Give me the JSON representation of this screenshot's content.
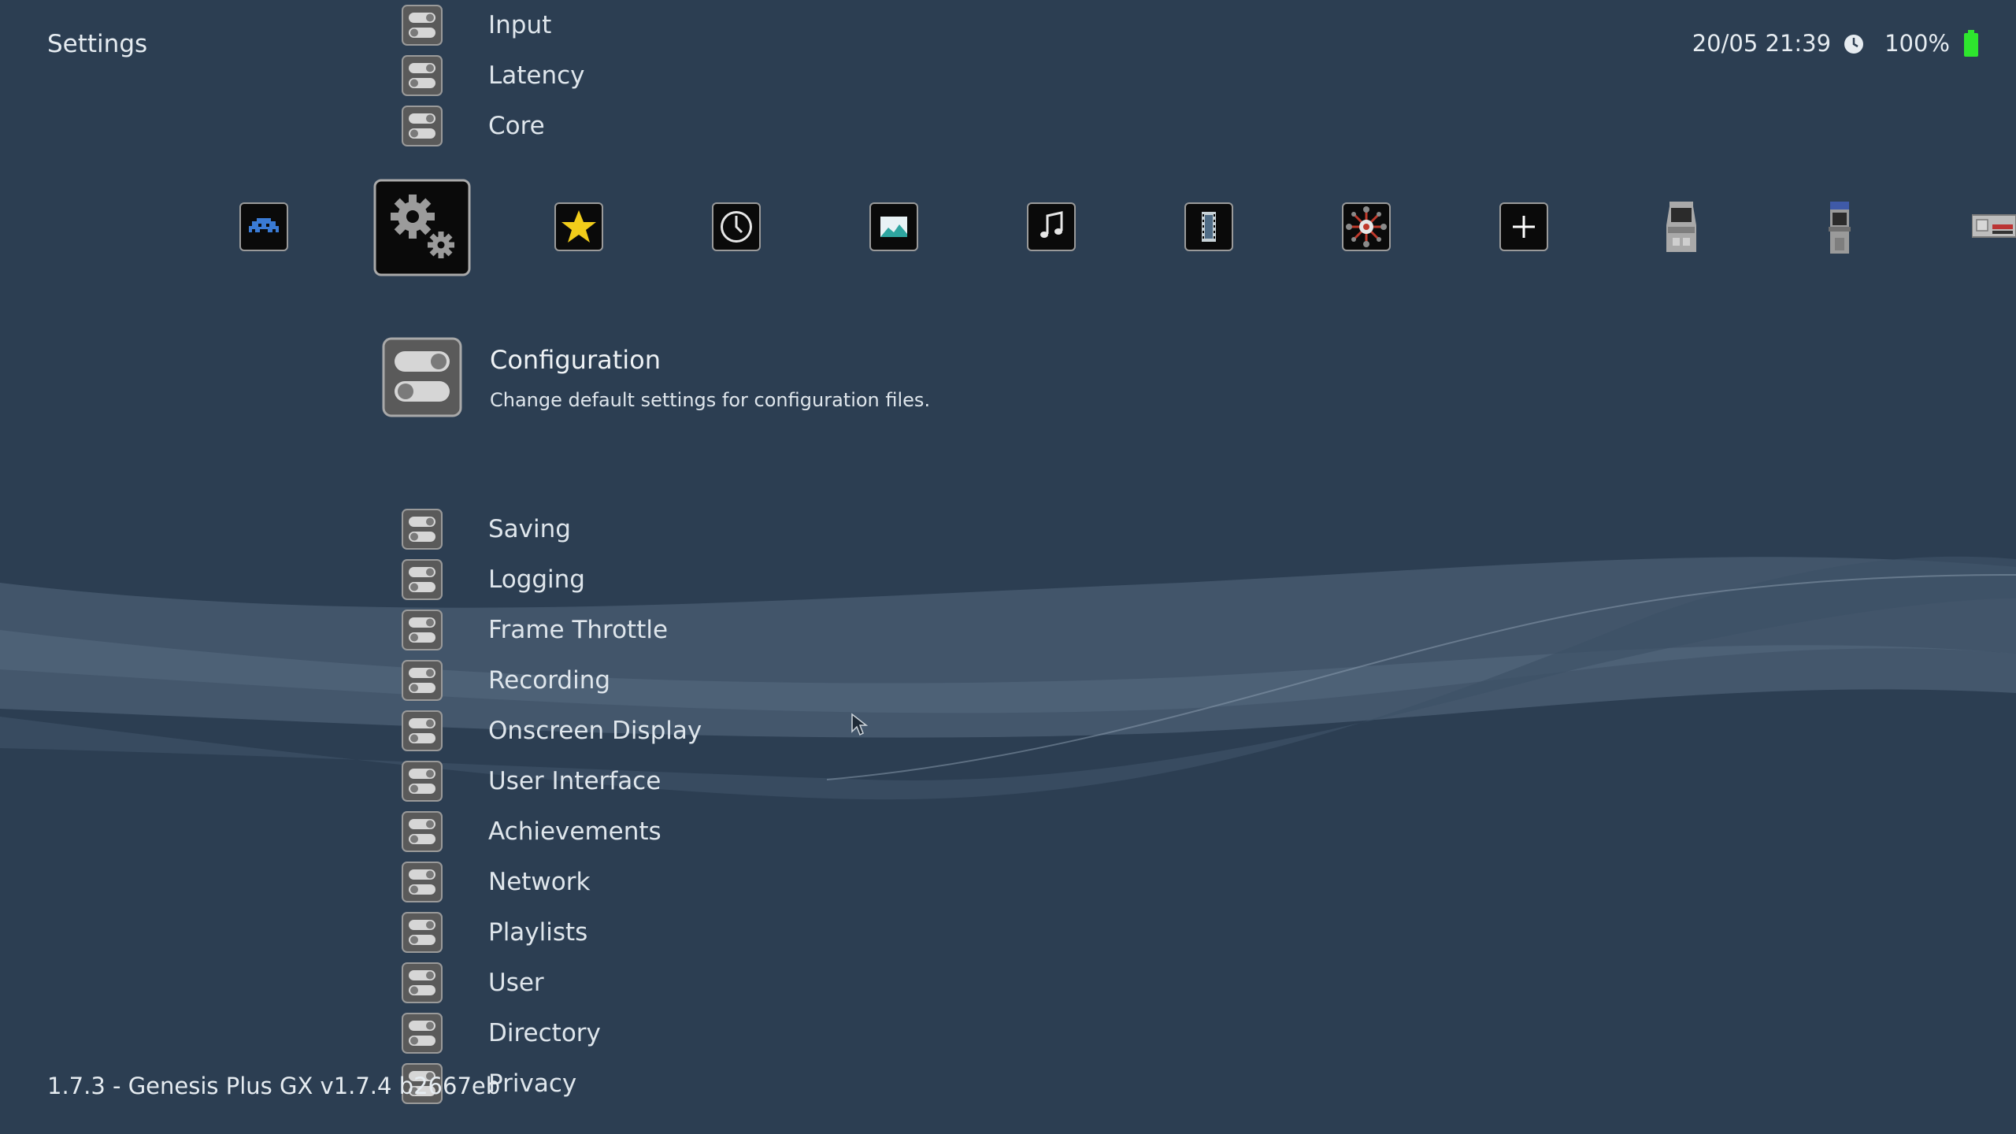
{
  "header": {
    "title": "Settings",
    "datetime": "20/05 21:39",
    "battery": "100%"
  },
  "colors": {
    "background": "#2c3e52",
    "battery_green": "#2ee62e",
    "icon_gray": "#7a7a7a",
    "star_yellow": "#f2cd1a",
    "invader_blue": "#3a7bd5"
  },
  "tabs": [
    {
      "name": "main-menu",
      "icon": "space-invader-icon"
    },
    {
      "name": "settings",
      "icon": "gears-icon",
      "selected": true
    },
    {
      "name": "favorites",
      "icon": "star-icon"
    },
    {
      "name": "history",
      "icon": "clock-icon"
    },
    {
      "name": "images",
      "icon": "picture-icon"
    },
    {
      "name": "music",
      "icon": "music-note-icon"
    },
    {
      "name": "videos",
      "icon": "film-icon"
    },
    {
      "name": "netplay",
      "icon": "netplay-icon"
    },
    {
      "name": "add",
      "icon": "plus-icon"
    },
    {
      "name": "arcade",
      "icon": "arcade-cabinet-icon"
    },
    {
      "name": "arcade-upright",
      "icon": "arcade-upright-icon"
    },
    {
      "name": "console",
      "icon": "nes-console-icon"
    }
  ],
  "menu": {
    "items_above": [
      {
        "label": "Input"
      },
      {
        "label": "Latency"
      },
      {
        "label": "Core"
      }
    ],
    "selected": {
      "label": "Configuration",
      "description": "Change default settings for configuration files."
    },
    "items_below": [
      {
        "label": "Saving"
      },
      {
        "label": "Logging"
      },
      {
        "label": "Frame Throttle"
      },
      {
        "label": "Recording"
      },
      {
        "label": "Onscreen Display"
      },
      {
        "label": "User Interface"
      },
      {
        "label": "Achievements"
      },
      {
        "label": "Network"
      },
      {
        "label": "Playlists"
      },
      {
        "label": "User"
      },
      {
        "label": "Directory"
      },
      {
        "label": "Privacy"
      }
    ]
  },
  "footer": {
    "version": "1.7.3 - Genesis Plus GX v1.7.4 b2667eb"
  }
}
